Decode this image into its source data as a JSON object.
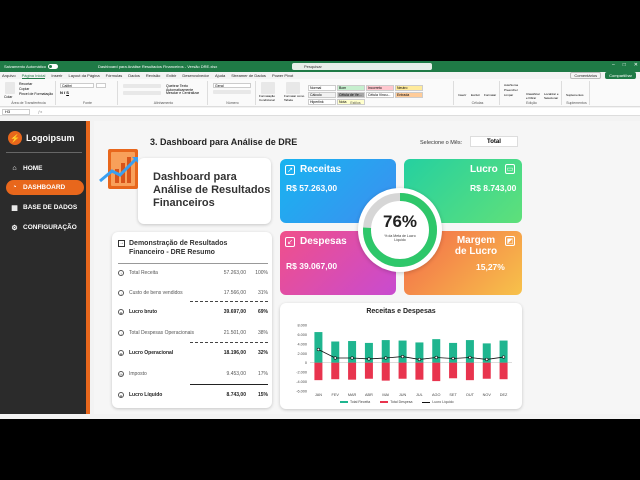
{
  "titlebar": {
    "autosave_label": "Salvamento Automático",
    "document_title": "Dashboard para Análise Resultados Financeiros - Versão DRE.xlsx",
    "search_placeholder": "Pesquisar"
  },
  "menu": {
    "items": [
      "Arquivo",
      "Página Inicial",
      "Inserir",
      "Layout da Página",
      "Fórmulas",
      "Dados",
      "Revisão",
      "Exibir",
      "Desenvolvedor",
      "Ajuda",
      "Streamer de Dados",
      "Power Pivot"
    ],
    "comments_label": "Comentários",
    "share_label": "Compartilhar"
  },
  "ribbon": {
    "groups": [
      "Área de Transferência",
      "Fonte",
      "Alinhamento",
      "Número",
      "Estilos",
      "Células",
      "Edição",
      "Suplementos"
    ],
    "font_name": "Calibri",
    "number_format": "Geral",
    "wrap_label": "Quebrar Texto Automaticamente",
    "merge_label": "Mesclar e Centralizar",
    "cell_styles": [
      "Normal",
      "Bom",
      "Incorreto",
      "Neutro",
      "Cálculo",
      "Célula de Ve...",
      "Célula Vincu...",
      "Entrada",
      "Hiperlink",
      "Nota"
    ],
    "cell_style_colors": [
      "#ffffff",
      "#c6efce",
      "#ffc7ce",
      "#ffeb9c",
      "#f2f2f2",
      "#a5a5a5",
      "#ffffff",
      "#ffcc99",
      "#ffffff",
      "#ffffcc"
    ],
    "buttons": [
      "Colar",
      "Recortar",
      "Copiar",
      "Pincel de Formatação",
      "Formatação Condicional",
      "Formatar como Tabela",
      "Inserir",
      "Excluir",
      "Formatar",
      "AutoSoma",
      "Preencher",
      "Limpar",
      "Classificar e Filtrar",
      "Localizar e Selecionar",
      "Suplementos"
    ],
    "name_box": "H3"
  },
  "sidebar": {
    "logo_text": "Logoipsum",
    "items": [
      {
        "label": "HOME",
        "icon": "home-icon",
        "active": false
      },
      {
        "label": "DASHBOARD",
        "icon": "dashboard-icon",
        "active": true
      },
      {
        "label": "BASE DE DADOS",
        "icon": "database-icon",
        "active": false
      },
      {
        "label": "CONFIGURAÇÃO",
        "icon": "gear-icon",
        "active": false
      }
    ],
    "accent": "#e8671c"
  },
  "main": {
    "page_title": "3. Dashboard para Análise de DRE",
    "month_label": "Selecione o Mês:",
    "month_value": "Total",
    "header_card_title": "Dashboard para Análise de Resultados Financeiros"
  },
  "dre": {
    "title": "Demonstração de Resultados Financeiro - DRE Resumo",
    "rows": [
      {
        "label": "Total Receita",
        "value": "57.263,00",
        "pct": "100%",
        "bold": false
      },
      {
        "label": "Custo de bens vendidos",
        "value": "17.566,00",
        "pct": "31%",
        "bold": false
      },
      {
        "label": "Lucro bruto",
        "value": "39.697,00",
        "pct": "69%",
        "bold": true
      },
      {
        "label": "Total Despesas Operacionais",
        "value": "21.501,00",
        "pct": "38%",
        "bold": false
      },
      {
        "label": "Lucro Operacional",
        "value": "18.196,00",
        "pct": "32%",
        "bold": true
      },
      {
        "label": "Imposto",
        "value": "9.453,00",
        "pct": "17%",
        "bold": false
      },
      {
        "label": "Lucro Líquido",
        "value": "8.743,00",
        "pct": "15%",
        "bold": true
      }
    ]
  },
  "kpis": {
    "receitas": {
      "label": "Receitas",
      "value": "R$ 57.263,00",
      "icon": "arrow-up-right-icon"
    },
    "lucro": {
      "label": "Lucro",
      "value": "R$ 8.743,00",
      "icon": "wallet-icon"
    },
    "despesas": {
      "label": "Despesas",
      "value": "R$ 39.067,00",
      "icon": "arrow-down-left-icon"
    },
    "margem": {
      "label": "Margem de Lucro",
      "value": "15,27%",
      "icon": "chart-icon"
    }
  },
  "gauge": {
    "percent_label": "76%",
    "fraction": 0.76,
    "sub_label": "% da Meta de Lucro Líquido",
    "color": "#2ec76a"
  },
  "chart_data": {
    "type": "bar",
    "title": "Receitas e Despesas",
    "categories": [
      "JAN",
      "FEV",
      "MAR",
      "ABR",
      "MAI",
      "JUN",
      "JUL",
      "AGO",
      "SET",
      "OUT",
      "NOV",
      "DEZ"
    ],
    "y_ticks": [
      "8.000",
      "6.000",
      "4.000",
      "2.000",
      "0",
      "-2.000",
      "-4.000",
      "-6.000"
    ],
    "ylim": [
      -6000,
      8000
    ],
    "series": [
      {
        "name": "Total Receita",
        "color": "#1fb58f",
        "values": [
          6500,
          4500,
          4600,
          4200,
          4800,
          4700,
          4300,
          5000,
          4200,
          4800,
          4100,
          4700
        ]
      },
      {
        "name": "Total Despesa",
        "color": "#e8344e",
        "values": [
          -3700,
          -3500,
          -3600,
          -3400,
          -3800,
          -3400,
          -3600,
          -3900,
          -3300,
          -3700,
          -3400,
          -3500
        ]
      },
      {
        "name": "Lucro Líquido",
        "color": "#111111",
        "values": [
          2800,
          1000,
          1000,
          800,
          1000,
          1300,
          700,
          1100,
          900,
          1100,
          700,
          1200
        ]
      }
    ]
  }
}
